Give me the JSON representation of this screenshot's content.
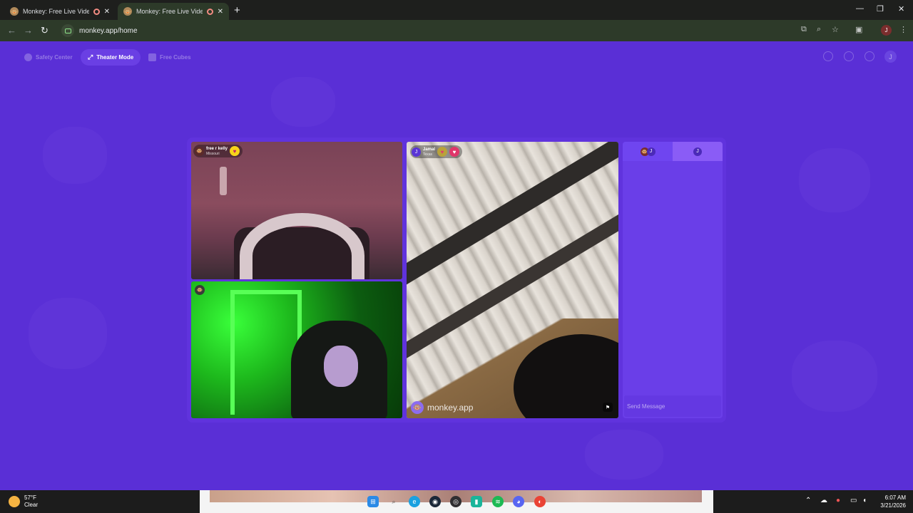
{
  "browser": {
    "tabs": [
      {
        "title": "Monkey: Free Live Video Ch",
        "active": false
      },
      {
        "title": "Monkey: Free Live Video Ch",
        "active": true
      }
    ],
    "new_tab": "+",
    "url": "monkey.app/home",
    "profile_initial": "J",
    "window_controls": {
      "minimize": "—",
      "restore": "❐",
      "close": "✕"
    }
  },
  "header": {
    "nav": [
      {
        "label": "Safety Center",
        "active": false
      },
      {
        "label": "Theater Mode",
        "active": true
      },
      {
        "label": "Free Cubes",
        "active": false
      }
    ],
    "avatar_initial": "J"
  },
  "videos": {
    "self": {
      "name": "free r kelly",
      "location": "Missouri"
    },
    "remote": {
      "name": "Jamal",
      "location": "Texas",
      "initial": "J"
    },
    "watermark": "monkey.app"
  },
  "chat": {
    "tab_b_initial": "J",
    "tab_a_initial": "J",
    "input_placeholder": "Send Message"
  },
  "taskbar": {
    "weather": {
      "temp": "57°F",
      "condition": "Clear"
    },
    "clock": {
      "time": "6:07 AM",
      "date": "3/21/2026"
    },
    "apps": [
      "windows-icon",
      "search-icon",
      "edge-icon",
      "steam-icon",
      "obs-icon",
      "twitch-icon",
      "spotify-icon",
      "discord-icon",
      "chrome-icon"
    ]
  },
  "colors": {
    "page_bg": "#5a2fd6",
    "accent": "#6a3fe4",
    "browser_chrome": "#2d3a29"
  }
}
